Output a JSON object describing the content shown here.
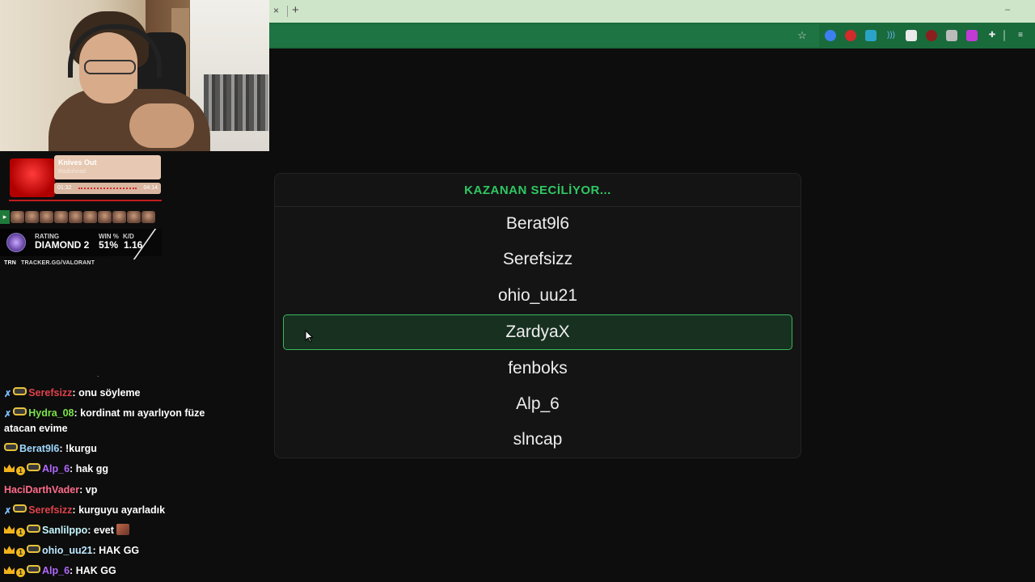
{
  "music": {
    "song": "Knives Out",
    "artist": "Radiohead",
    "elapsed": "01:32",
    "duration": "04:14"
  },
  "rank": {
    "rating_label": "RATING",
    "rating_value": "DIAMOND 2",
    "win_label": "WIN %",
    "win_value": "51%",
    "kd_label": "K/D",
    "kd_value": "1.16"
  },
  "tracker": {
    "brand": "TRN",
    "url": "TRACKER.GG/VALORANT"
  },
  "stray": ".",
  "chat": [
    {
      "badges": [
        "sword-icon",
        "glasses-icon"
      ],
      "user": "Serefsizz",
      "color": "#e0424a",
      "text": "onu söyleme"
    },
    {
      "badges": [
        "sword-icon",
        "glasses-icon"
      ],
      "user": "Hydra_08",
      "color": "#7be34a",
      "text": "kordinat mı ayarlıyon füze atacan evime"
    },
    {
      "badges": [
        "glasses-icon"
      ],
      "user": "Berat9l6",
      "color": "#9fd8ff",
      "text": "!kurgu"
    },
    {
      "badges": [
        "crown-icon",
        "one-icon",
        "glasses-icon"
      ],
      "user": "Alp_6",
      "color": "#b169ff",
      "text": "hak gg"
    },
    {
      "badges": [],
      "user": "HaciDarthVader",
      "color": "#ff6b8a",
      "text": "vp"
    },
    {
      "badges": [
        "sword-icon",
        "glasses-icon"
      ],
      "user": "Serefsizz",
      "color": "#e0424a",
      "text": "kurguyu ayarladık"
    },
    {
      "badges": [
        "crown-icon",
        "one-icon",
        "glasses-icon"
      ],
      "user": "Sanlilppo",
      "color": "#c6f7ff",
      "text": "evet",
      "emote": true
    },
    {
      "badges": [
        "crown-icon",
        "one-icon",
        "glasses-icon"
      ],
      "user": "ohio_uu21",
      "color": "#bde8ff",
      "text": "HAK GG"
    },
    {
      "badges": [
        "crown-icon",
        "one-icon",
        "glasses-icon"
      ],
      "user": "Alp_6",
      "color": "#b169ff",
      "text": "HAK GG"
    }
  ],
  "browser": {
    "close_tab": "×",
    "new_tab": "+"
  },
  "picker": {
    "title": "KAZANAN SECİLİYOR...",
    "title_color": "#2fc862",
    "active_index": 3,
    "names": [
      "Berat9l6",
      "Serefsizz",
      "ohio_uu21",
      "ZardyaX",
      "fenboks",
      "Alp_6",
      "slncap"
    ]
  }
}
